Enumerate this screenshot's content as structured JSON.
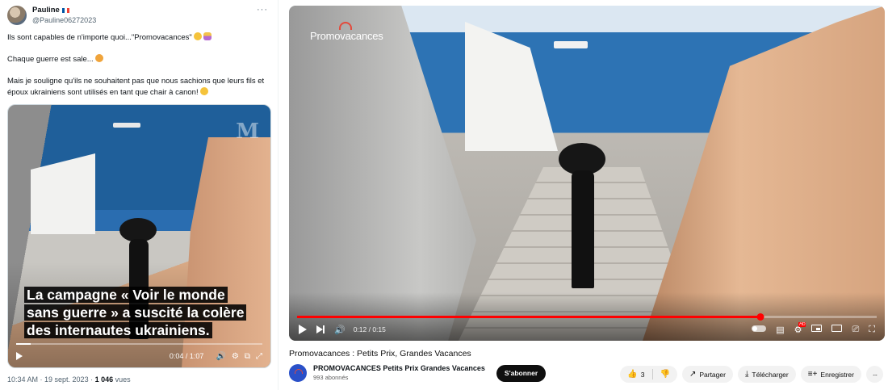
{
  "tweet": {
    "author_name": "Pauline",
    "author_handle": "@Pauline06272023",
    "more_label": "···",
    "paragraphs": [
      "Ils sont capables de n'importe quoi...\"Promovacances\"",
      "Chaque guerre est sale...",
      "Mais je souligne qu'ils ne souhaitent pas que nous sachions que leurs fils et époux ukrainiens sont utilisés en tant que chair à canon!"
    ],
    "media": {
      "watermark": "M",
      "caption": "La campagne « Voir le monde sans guerre » a suscité la colère des internautes ukrainiens.",
      "time": "0:04 / 1:07",
      "progress": 0.06
    },
    "footer_time": "10:34 AM · 19 sept. 2023 · ",
    "footer_views_count": "1 046",
    "footer_views_label": " vues"
  },
  "youtube": {
    "overlay_logo": "Promovacances",
    "time": "0:12 / 0:15",
    "progress": 0.8,
    "controls": {
      "play": "▶",
      "volume": "🔊",
      "hd_badge": "HD"
    },
    "title": "Promovacances : Petits Prix, Grandes Vacances",
    "channel_name": "PROMOVACANCES Petits Prix Grandes Vacances",
    "channel_subs": "993 abonnés",
    "subscribe_label": "S'abonner",
    "like_count": "3",
    "share_label": "Partager",
    "download_label": "Télécharger",
    "save_label": "Enregistrer",
    "more_label": "···"
  }
}
